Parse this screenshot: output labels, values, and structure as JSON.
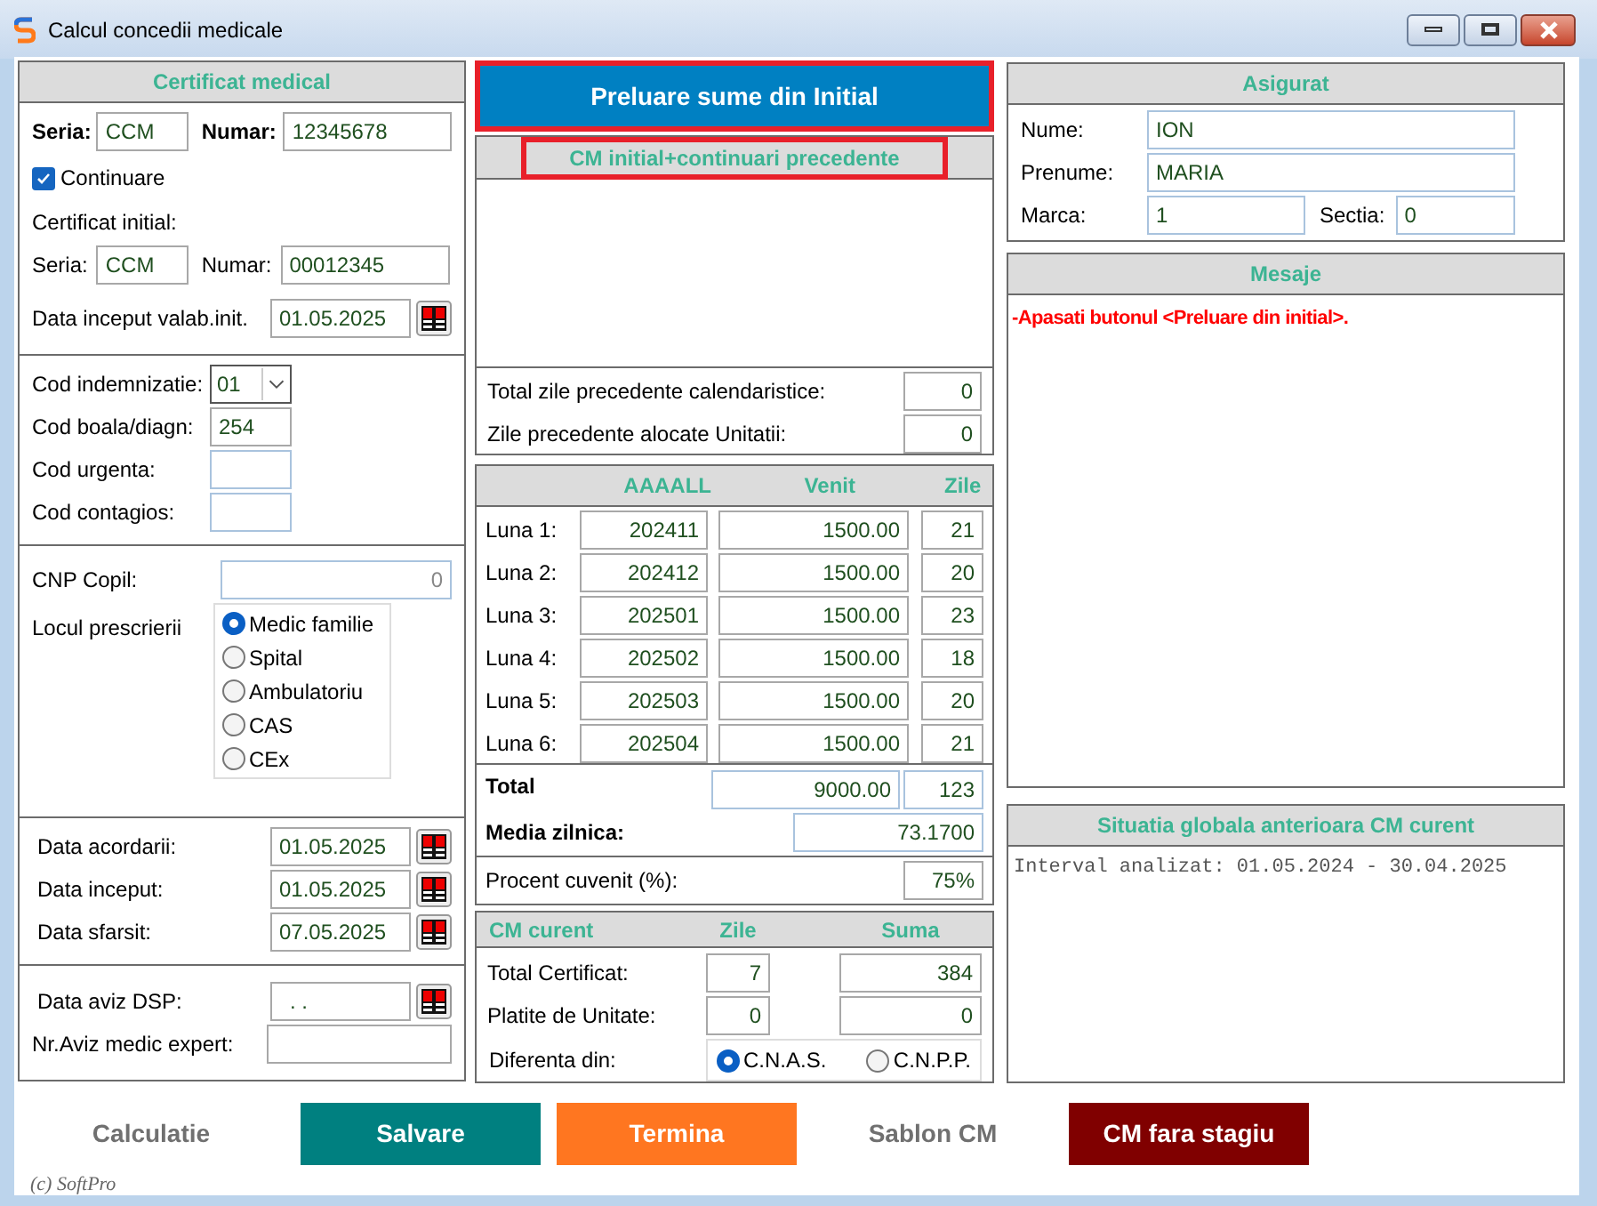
{
  "window": {
    "title": "Calcul concedii medicale"
  },
  "certificat": {
    "title": "Certificat medical",
    "seria_label": "Seria:",
    "seria": "CCM",
    "numar_label": "Numar:",
    "numar": "12345678",
    "continuare": {
      "label": "Continuare",
      "checked": true
    },
    "initial_label": "Certificat initial:",
    "initial_seria_label": "Seria:",
    "initial_seria": "CCM",
    "initial_numar_label": "Numar:",
    "initial_numar": "00012345",
    "data_init_label": "Data inceput valab.init.",
    "data_init": "01.05.2025"
  },
  "codes": [
    {
      "kind": "dropdown",
      "label": "Cod indemnizatie:",
      "value": "01"
    },
    {
      "kind": "text",
      "label": "Cod boala/diagn:",
      "value": "254"
    },
    {
      "kind": "text",
      "label": "Cod urgenta:"
    },
    {
      "kind": "text",
      "label": "Cod contagios:"
    }
  ],
  "cnp": {
    "label": "CNP Copil:",
    "value": "0"
  },
  "locul": {
    "label": "Locul prescrierii",
    "options": [
      {
        "label": "Medic familie",
        "selected": true
      },
      {
        "label": "Spital",
        "selected": false
      },
      {
        "label": "Ambulatoriu",
        "selected": false
      },
      {
        "label": "CAS",
        "selected": false
      },
      {
        "label": "CEx",
        "selected": false
      }
    ]
  },
  "dates": [
    {
      "label": "Data acordarii:",
      "value": "01.05.2025"
    },
    {
      "label": "Data inceput:",
      "value": "01.05.2025"
    },
    {
      "label": "Data sfarsit:",
      "value": "07.05.2025"
    }
  ],
  "aviz": {
    "dsp_label": "Data aviz DSP:",
    "dsp_value": ". .",
    "expert_label": "Nr.Aviz medic expert:"
  },
  "preluare_button": {
    "label": "Preluare sume din Initial",
    "highlighted": true
  },
  "cm_initial": {
    "title": "CM initial+continuari precedente",
    "highlighted": true,
    "rows": [
      {
        "label": "Total zile precedente calendaristice:",
        "value": "0"
      },
      {
        "label": "Zile precedente alocate Unitatii:",
        "value": "0"
      }
    ]
  },
  "luni": {
    "columns": [
      "AAAALL",
      "Venit",
      "Zile"
    ],
    "rows": [
      {
        "label": "Luna 1:",
        "period": "202411",
        "venit": "1500.00",
        "zile": "21"
      },
      {
        "label": "Luna 2:",
        "period": "202412",
        "venit": "1500.00",
        "zile": "20"
      },
      {
        "label": "Luna 3:",
        "period": "202501",
        "venit": "1500.00",
        "zile": "23"
      },
      {
        "label": "Luna 4:",
        "period": "202502",
        "venit": "1500.00",
        "zile": "18"
      },
      {
        "label": "Luna 5:",
        "period": "202503",
        "venit": "1500.00",
        "zile": "20"
      },
      {
        "label": "Luna 6:",
        "period": "202504",
        "venit": "1500.00",
        "zile": "21"
      }
    ],
    "total_label": "Total",
    "total_venit": "9000.00",
    "total_zile": "123",
    "media_label": "Media zilnica:",
    "media": "73.1700",
    "procent_label": "Procent cuvenit (%):",
    "procent": "75%"
  },
  "cm_curent": {
    "columns": [
      "CM curent",
      "Zile",
      "Suma"
    ],
    "rows": [
      {
        "label": "Total Certificat:",
        "zile": "7",
        "suma": "384"
      },
      {
        "label": "Platite de Unitate:",
        "zile": "0",
        "suma": "0"
      }
    ],
    "diferenta_label": "Diferenta din:",
    "options": [
      {
        "label": "C.N.A.S.",
        "selected": true
      },
      {
        "label": "C.N.P.P.",
        "selected": false
      }
    ]
  },
  "asigurat": {
    "title": "Asigurat",
    "nume_label": "Nume:",
    "nume": "ION",
    "prenume_label": "Prenume:",
    "prenume": "MARIA",
    "marca_label": "Marca:",
    "marca": "1",
    "sectia_label": "Sectia:",
    "sectia": "0"
  },
  "mesaje": {
    "title": "Mesaje",
    "messages": [
      "-Apasati butonul <Preluare din initial>."
    ]
  },
  "situatia": {
    "title": "Situatia globala anterioara CM curent",
    "text": "Interval analizat: 01.05.2024 - 30.04.2025"
  },
  "buttons": [
    {
      "label": "Calculatie",
      "kind": "plain"
    },
    {
      "label": "Salvare",
      "kind": "teal"
    },
    {
      "label": "Termina",
      "kind": "orange"
    },
    {
      "label": "Sablon CM",
      "kind": "plain"
    },
    {
      "label": "CM fara stagiu",
      "kind": "maroon"
    }
  ],
  "footer": "(c) SoftPro"
}
